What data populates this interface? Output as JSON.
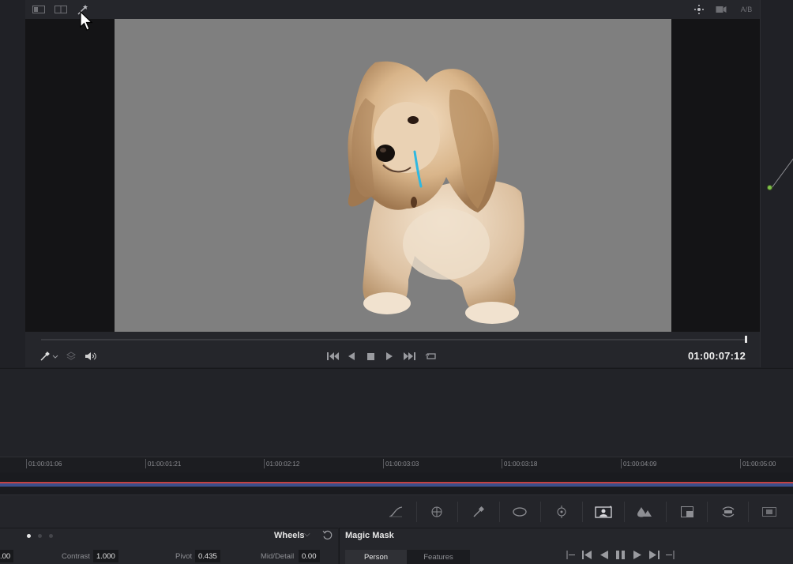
{
  "viewer": {
    "toolbar_icons": [
      "single-viewer-icon",
      "split-viewer-icon",
      "magic-wand-icon",
      "highlight-icon",
      "camera-icon",
      "ab-compare-icon"
    ],
    "ab_label": "A/B",
    "timecode": "01:00:07:12",
    "playhead_fraction": 1.0,
    "image_subject": "dog on grey background"
  },
  "timeline": {
    "ticks": [
      "01:00:01:06",
      "01:00:01:21",
      "01:00:02:12",
      "01:00:03:03",
      "01:00:03:18",
      "01:00:04:09",
      "01:00:05:00"
    ]
  },
  "palette": {
    "icons": [
      "curves-icon",
      "color-warper-icon",
      "qualifier-icon",
      "window-icon",
      "tracker-icon",
      "magic-mask-icon",
      "blur-icon",
      "key-icon",
      "sizing-icon",
      "3d-icon"
    ]
  },
  "primaries": {
    "mode_label": "Wheels",
    "params": [
      {
        "label": "",
        "value": ".00"
      },
      {
        "label": "Contrast",
        "value": "1.000"
      },
      {
        "label": "Pivot",
        "value": "0.435"
      },
      {
        "label": "Mid/Detail",
        "value": "0.00"
      }
    ]
  },
  "magic_mask": {
    "title": "Magic Mask",
    "modes": [
      "Person",
      "Features"
    ],
    "active_mode": "Person"
  },
  "colors": {
    "accent_green": "#7fc04a",
    "timeline_clip": "#3b4f8c",
    "timeline_red": "#c24242"
  }
}
